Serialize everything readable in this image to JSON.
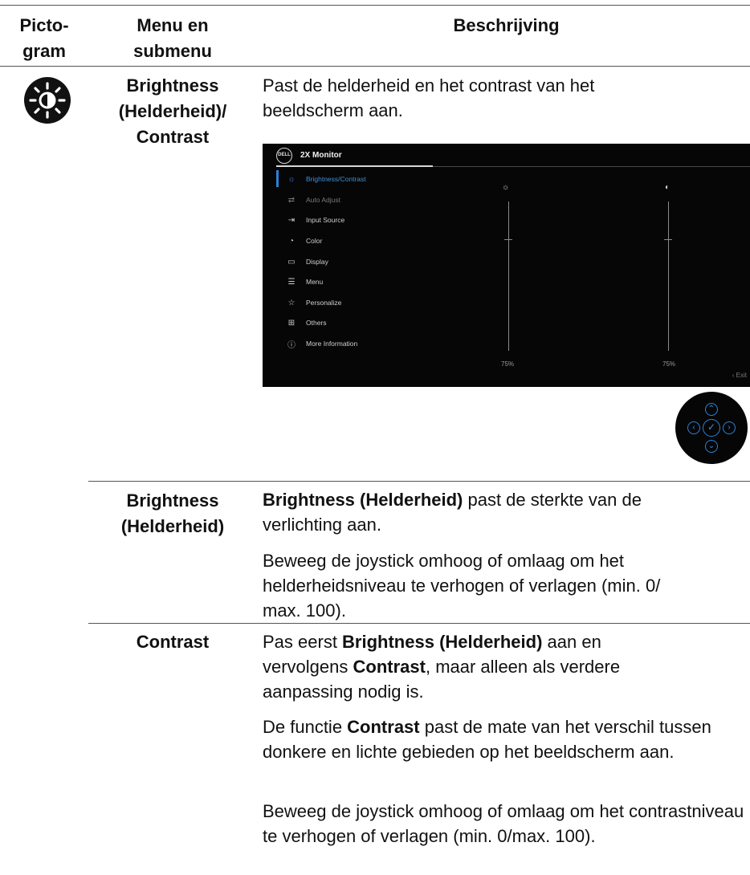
{
  "header": {
    "col1": "Picto-\ngram",
    "col2": "Menu en\nsubmenu",
    "col3": "Beschrijving"
  },
  "row1": {
    "icon": "brightness-sun-icon",
    "menu": "Brightness\n(Helderheid)/\nContrast",
    "desc": "Past de helderheid en het contrast van het beeldscherm aan."
  },
  "osd": {
    "logo": "DELL",
    "title": "2X Monitor",
    "items": [
      {
        "icon": "sun-icon",
        "label": "Brightness/Contrast"
      },
      {
        "icon": "swap-icon",
        "label": "Auto Adjust"
      },
      {
        "icon": "input-icon",
        "label": "Input Source"
      },
      {
        "icon": "palette-icon",
        "label": "Color"
      },
      {
        "icon": "monitor-icon",
        "label": "Display"
      },
      {
        "icon": "menu-icon",
        "label": "Menu"
      },
      {
        "icon": "star-icon",
        "label": "Personalize"
      },
      {
        "icon": "others-icon",
        "label": "Others"
      },
      {
        "icon": "info-icon",
        "label": "More Information"
      }
    ],
    "brightness_value": "75%",
    "contrast_value": "75%",
    "brightness_level": 0.75,
    "contrast_level": 0.75,
    "exit_label": "Exit",
    "accent_color": "#2b82d9"
  },
  "row2": {
    "menu": "Brightness\n(Helderheid)",
    "p1_bold": "Brightness (Helderheid)",
    "p1_text": " past de sterkte van de verlichting aan.",
    "p2": "Beweeg de joystick omhoog of omlaag om het helderheidsniveau te verhogen of verlagen (min. 0/ max. 100)."
  },
  "row3": {
    "menu": "Contrast",
    "p1_a": "Pas eerst ",
    "p1_b": "Brightness (Helderheid)",
    "p1_c": " aan en vervolgens ",
    "p1_d": "Contrast",
    "p1_e": ", maar alleen als verdere aanpassing nodig is.",
    "p2_a": "De functie ",
    "p2_b": "Contrast",
    "p2_c": " past de mate van het verschil tussen donkere en lichte gebieden op het beeldscherm aan.",
    "p3": "Beweeg de joystick omhoog of omlaag om het contrastniveau te verhogen of verlagen (min. 0/max. 100)."
  }
}
